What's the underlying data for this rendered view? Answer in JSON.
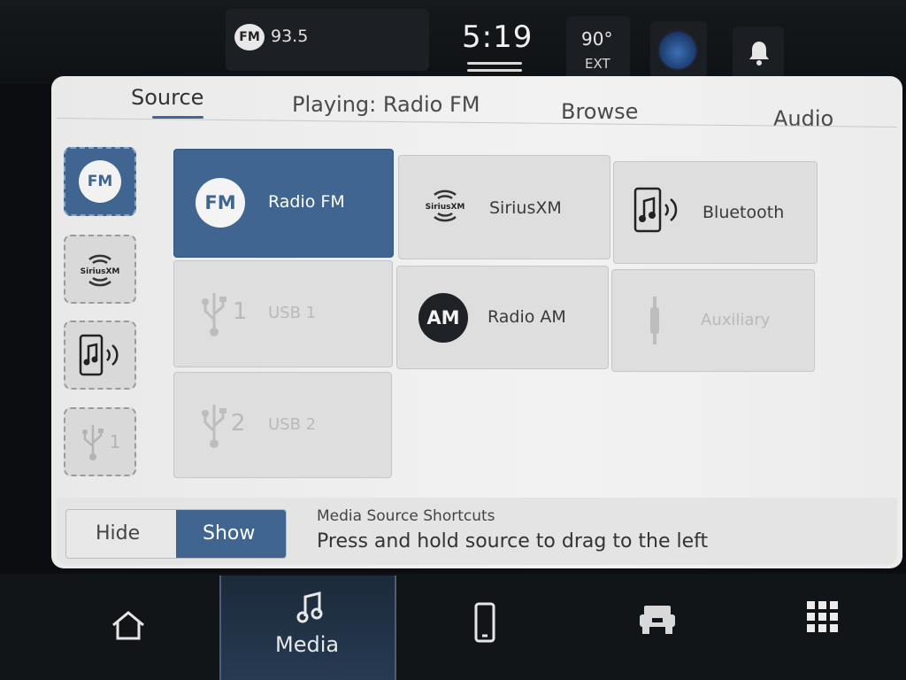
{
  "status_bar": {
    "radio_band": "FM",
    "frequency": "93.5",
    "time": "5:19",
    "temperature": "90°",
    "temperature_label": "EXT"
  },
  "tabs": [
    {
      "label": "Source",
      "active": true
    },
    {
      "label": "Playing: Radio FM",
      "active": false
    },
    {
      "label": "Browse",
      "active": false
    },
    {
      "label": "Audio",
      "active": false
    }
  ],
  "shortcuts": [
    {
      "icon": "fm-icon",
      "badge": "FM",
      "active": true
    },
    {
      "icon": "siriusxm-icon",
      "badge": "SiriusXM",
      "active": false
    },
    {
      "icon": "bluetooth-phone-icon",
      "active": false
    },
    {
      "icon": "usb-icon",
      "number": "1",
      "active": false
    }
  ],
  "sources": [
    {
      "label": "Radio FM",
      "badge": "FM",
      "state": "selected"
    },
    {
      "label": "SiriusXM",
      "badge": "SiriusXM",
      "state": "enabled"
    },
    {
      "label": "Bluetooth",
      "state": "enabled"
    },
    {
      "label": "USB 1",
      "number": "1",
      "state": "disabled"
    },
    {
      "label": "Radio AM",
      "badge": "AM",
      "state": "enabled"
    },
    {
      "label": "Auxiliary",
      "state": "disabled"
    },
    {
      "label": "USB 2",
      "number": "2",
      "state": "disabled"
    }
  ],
  "shortcut_toggle": {
    "hide_label": "Hide",
    "show_label": "Show",
    "selected": "Show"
  },
  "hint": {
    "title": "Media Source Shortcuts",
    "text": "Press and hold source to drag to the left"
  },
  "bottom_nav": [
    {
      "icon": "home-icon"
    },
    {
      "icon": "music-note-icon",
      "label": "Media",
      "active": true
    },
    {
      "icon": "phone-icon"
    },
    {
      "icon": "truck-icon"
    },
    {
      "icon": "apps-grid-icon"
    }
  ],
  "colors": {
    "accent": "#3f6590",
    "panel": "#ececec",
    "chrome": "#121518"
  }
}
